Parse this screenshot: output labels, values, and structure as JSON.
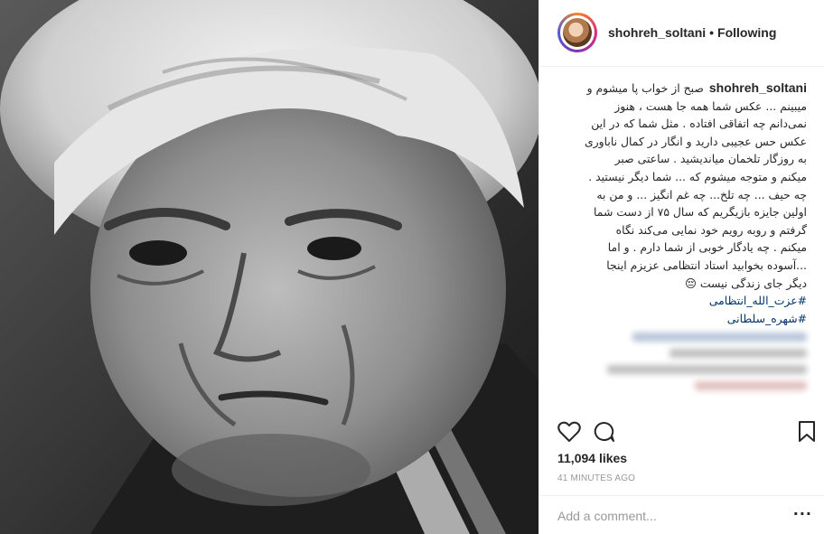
{
  "header": {
    "username": "shohreh_soltani",
    "separator": "•",
    "follow_status": "Following"
  },
  "caption": {
    "username": "shohreh_soltani",
    "lines": [
      "صبح از خواب پا میشوم و",
      "میبینم ... عکس شما همه جا هست ، هنوز",
      "نمی‌دانم چه اتفاقی افتاده . مثل شما که در این",
      "عکس حس عجیبی دارید و انگار در کمال ناباوری",
      "به روزگار تلخمان میاندیشید . ساعتی صبر",
      "میکنم و متوجه میشوم که ... شما دیگر نیستید .",
      "چه حیف ... چه تلخ... چه غم انگیز ... و من به",
      "اولین جایزه بازیگریم که سال ۷۵ از دست شما",
      "گرفتم و روبه رویم خود نمایی می‌کند نگاه",
      "میکنم . چه یادگار خوبی از شما دارم . و اما",
      "...آسوده بخوابید استاد انتظامی عزیزم اینجا",
      "دیگر جای زندگی نیست 😔"
    ],
    "hashtags": [
      "#عزت_الله_انتظامی",
      "#شهره_سلطانی"
    ]
  },
  "engagement": {
    "likes": "11,094 likes",
    "time_ago": "41 MINUTES AGO"
  },
  "comment_box": {
    "placeholder": "Add a comment...",
    "more": "···"
  },
  "icons": {
    "like": "heart-icon",
    "comment": "comment-icon",
    "save": "bookmark-icon"
  },
  "colors": {
    "text": "#262626",
    "muted": "#999999",
    "hashtag": "#003569",
    "border": "#efefef"
  }
}
